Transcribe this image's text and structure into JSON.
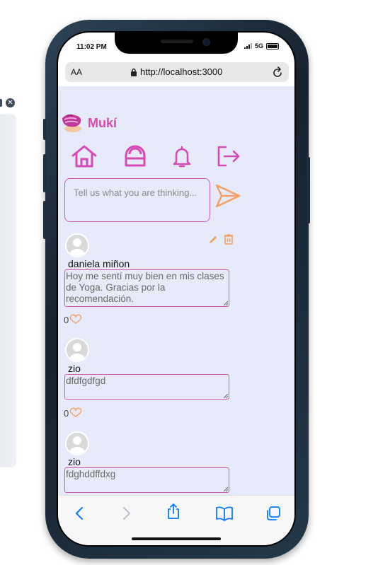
{
  "status": {
    "time": "11:02 PM",
    "network": "5G"
  },
  "browser": {
    "aa_label": "AA",
    "url": "http://localhost:3000"
  },
  "app": {
    "brand": "Mukí",
    "composer_placeholder": "Tell us what you are thinking...",
    "posts": [
      {
        "author": "daniela miñon",
        "text": "Hoy me sentí muy bien en mis clases de Yoga. Gracias por la recomendación.",
        "likes": "0"
      },
      {
        "author": "zio",
        "text": "dfdfgdfgd",
        "likes": "0"
      },
      {
        "author": "zio",
        "text": "fdghddffdxg",
        "likes": ""
      }
    ]
  },
  "colors": {
    "brand": "#d54bb6",
    "accent": "#f4a064",
    "background": "#e7eaf9",
    "ios_blue": "#0a7aff"
  },
  "icons": [
    "home-icon",
    "padlock-icon",
    "bell-icon",
    "logout-icon",
    "send-icon",
    "pencil-icon",
    "trash-icon",
    "heart-icon",
    "back-icon",
    "forward-icon",
    "share-icon",
    "bookmarks-icon",
    "tabs-icon"
  ]
}
